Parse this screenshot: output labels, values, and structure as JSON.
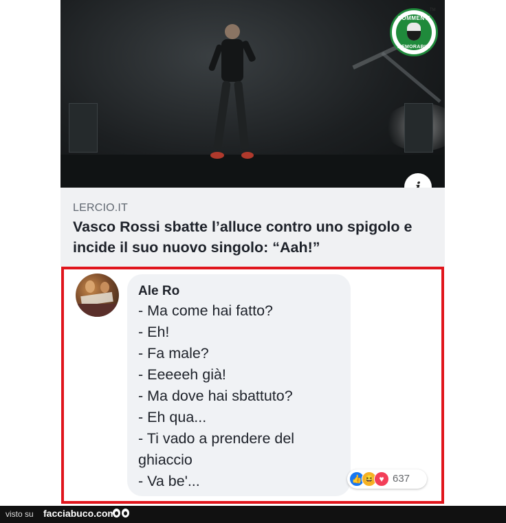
{
  "post_image": {
    "badge": {
      "top_text": "COMMENTI",
      "bottom_text": "MEMORABILI",
      "tm": "TM"
    },
    "info_icon": "info-icon"
  },
  "link_preview": {
    "domain": "LERCIO.IT",
    "headline": "Vasco Rossi sbatte l’alluce contro uno spigolo e incide il suo nuovo singolo: “Aah!”"
  },
  "comment": {
    "author": "Ale Ro",
    "lines": [
      "- Ma come hai fatto?",
      "- Eh!",
      "- Fa male?",
      "- Eeeeeh già!",
      "- Ma dove hai sbattuto?",
      "- Eh qua...",
      "- Ti vado a prendere del",
      "ghiaccio",
      "- Va be'..."
    ],
    "reactions": {
      "icons": [
        "like-icon",
        "haha-icon",
        "love-icon"
      ],
      "count": "637"
    },
    "highlight_color": "#e0151c"
  },
  "footer": {
    "visto_su": "visto su",
    "site": "facciabuco.com"
  }
}
